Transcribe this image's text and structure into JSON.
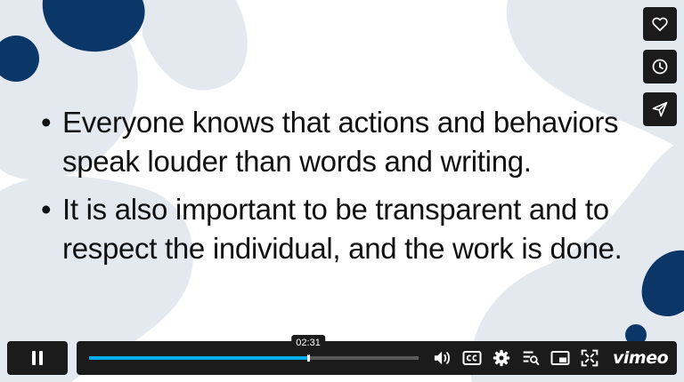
{
  "slide": {
    "bullets": [
      "Everyone knows that actions and behaviors speak louder than words and writing.",
      "It is also important to be transparent and to respect the individual, and the work is done."
    ],
    "bullet_glyph": "•"
  },
  "side_actions": {
    "like": {
      "icon": "heart-icon"
    },
    "watch_later": {
      "icon": "clock-icon"
    },
    "share": {
      "icon": "paper-plane-icon"
    }
  },
  "controls": {
    "play_state": "playing",
    "pause_icon": "pause-icon",
    "progress_fraction": 0.665,
    "hover_time": "02:31",
    "icons": [
      "volume-icon",
      "closed-captions-icon",
      "settings-gear-icon",
      "chapters-icon",
      "picture-in-picture-icon",
      "fullscreen-icon"
    ],
    "brand": "vimeo"
  },
  "colors": {
    "slide_navy": "#0b3668",
    "slide_light": "#e4e9f0",
    "progress": "#00adef",
    "control_bg": "#1b1b1b"
  }
}
